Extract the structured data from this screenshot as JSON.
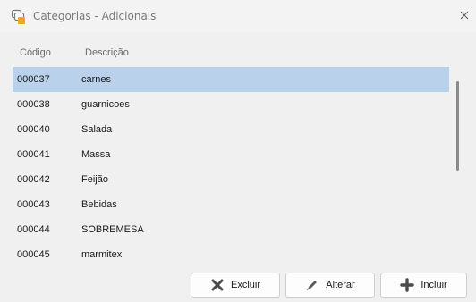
{
  "window": {
    "title": "Categorias - Adicionais"
  },
  "table": {
    "columns": {
      "code": "Código",
      "description": "Descrição"
    },
    "rows": [
      {
        "code": "000037",
        "description": "carnes",
        "selected": true
      },
      {
        "code": "000038",
        "description": "guarnicoes"
      },
      {
        "code": "000040",
        "description": "Salada"
      },
      {
        "code": "000041",
        "description": "Massa"
      },
      {
        "code": "000042",
        "description": "Feijão"
      },
      {
        "code": "000043",
        "description": "Bebidas"
      },
      {
        "code": "000044",
        "description": "SOBREMESA"
      },
      {
        "code": "000045",
        "description": "marmitex"
      }
    ]
  },
  "buttons": {
    "delete_label": "Excluir",
    "edit_label": "Alterar",
    "add_label": "Incluir"
  },
  "colors": {
    "selection": "#b9d1ea",
    "accent": "#f2a51a"
  },
  "icons": {
    "app": "categories-app-icon",
    "close": "close-icon",
    "delete": "x-icon",
    "edit": "pencil-icon",
    "add": "plus-icon"
  }
}
